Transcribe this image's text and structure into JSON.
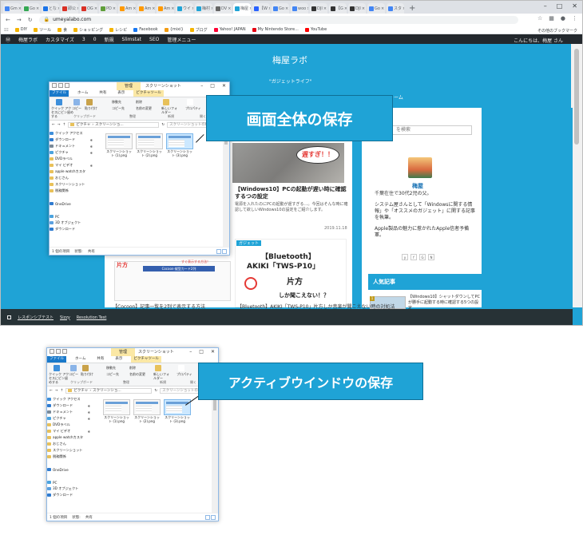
{
  "browser": {
    "tabs": [
      {
        "label": "Gm",
        "color": "#4285f4"
      },
      {
        "label": "Go",
        "color": "#34a853"
      },
      {
        "label": "とな",
        "color": "#1a73e8"
      },
      {
        "label": "即公",
        "color": "#d93025"
      },
      {
        "label": "OG",
        "color": "#d93025"
      },
      {
        "label": "PD",
        "color": "#5f9e3a"
      },
      {
        "label": "Am",
        "color": "#ff9900"
      },
      {
        "label": "Am",
        "color": "#ff9900"
      },
      {
        "label": "Am",
        "color": "#ff9900"
      },
      {
        "label": "ウイ",
        "color": "#1fa3d6"
      },
      {
        "label": "梅村",
        "color": "#1fa3d6"
      },
      {
        "label": "DV",
        "color": "#666666"
      },
      {
        "label": "梅屋",
        "color": "#1fa3d6",
        "active": true
      },
      {
        "label": "【W",
        "color": "#2962ff"
      },
      {
        "label": "Go",
        "color": "#4285f4"
      },
      {
        "label": "woo",
        "color": "#4285f4"
      },
      {
        "label": "DJI",
        "color": "#333333"
      },
      {
        "label": "【G",
        "color": "#333333"
      },
      {
        "label": "DJI",
        "color": "#333333"
      },
      {
        "label": "Go",
        "color": "#4285f4"
      },
      {
        "label": "スタ",
        "color": "#4285f4"
      }
    ],
    "url": "umeyalabo.com",
    "bookmarks": [
      {
        "label": "DIY",
        "color": "#f4b400"
      },
      {
        "label": "ツール",
        "color": "#f4b400"
      },
      {
        "label": "食",
        "color": "#f4b400"
      },
      {
        "label": "ショッピング",
        "color": "#f4b400"
      },
      {
        "label": "レシピ",
        "color": "#f4b400"
      },
      {
        "label": "Facebook",
        "color": "#1877f2"
      },
      {
        "label": "{mixi}",
        "color": "#f39c12"
      },
      {
        "label": "ブログ",
        "color": "#f4b400"
      },
      {
        "label": "Yahoo! JAPAN",
        "color": "#ff0033"
      },
      {
        "label": "My Nintendo Store...",
        "color": "#e60012"
      },
      {
        "label": "YouTube",
        "color": "#ff0000"
      }
    ],
    "bookmarks_right": "その他のブックマーク",
    "wp_admin": [
      "梅屋ラボ",
      "カスタマイズ",
      "3",
      "0",
      "新規",
      "Slimstat",
      "SEO",
      "管理メニュー"
    ],
    "wp_greeting": "こんにちは、梅屋 さん"
  },
  "site": {
    "title": "梅屋ラボ",
    "tagline": "\"ガジェットライフ\"",
    "nav": "フォーム",
    "search_placeholder": "を検索",
    "post1": {
      "bubble": "遅すぎ！！",
      "title": "【Windows10】PCの起動が遅い時に確認するつの設定",
      "excerpt": "電源を入れたのにPCの起動が遅すぎる…。今回はそんな時に確認して欲しいWindows10の設定をご紹介します。",
      "date": "2019.11.18"
    },
    "post2": {
      "badge": "ガジェット",
      "line1": "【Bluetooth】",
      "line2": "AKIKI「TWS-P10」",
      "line3": "片方",
      "line4": "しか聞こえない！？"
    },
    "author": {
      "name": "梅屋",
      "bio": [
        "千葉在住で30代2児の父。",
        "システム屋さんとして「Windowsに関する情報」や「オススメのガジェット」に関する記事を執筆。",
        "Apple製品の魅力に惹かれたApple信者予備軍。"
      ]
    },
    "social": [
      "y",
      "f",
      "G",
      "N"
    ],
    "popular_heading": "人気記事",
    "popular_item": "【Windows10】シャットダウンしてPCが勝手に起動する時に確認する5つの設定",
    "peek_red": "片方",
    "peek_bar": "Cocoon-縦型カード2列",
    "peek_bar2": "すぐ表示する方法！",
    "footer_left": "【Cocoon】記事一覧を2列で表示する方法",
    "footer_right": "【Bluetooth】AKIKI「TWS-P10」片方しか音楽が聞こえない時の対処法"
  },
  "recbar": [
    "レスポンシブテスト",
    "Sizzy",
    "Resolution Test"
  ],
  "explorer": {
    "manage_tab": "管理",
    "title": "スクリーンショット",
    "ribbon_tabs": [
      "ファイル",
      "ホーム",
      "共有",
      "表示",
      "ピクチャツール"
    ],
    "ribbon": {
      "quick_access": "クイック アクセスにピン留めする",
      "copy": "コピー",
      "paste": "貼り付け",
      "move_to": "移動先",
      "copy_to": "コピー先",
      "delete": "削除",
      "rename": "名前の変更",
      "new_folder": "新しいフォルダー",
      "properties": "プロパティ",
      "group_clipboard": "クリップボード",
      "group_organize": "整理",
      "group_new": "新規",
      "group_open": "開く"
    },
    "breadcrumb": [
      "ピクチャ",
      "スクリーンショ..."
    ],
    "search_placeholder": "スクリーンショットの検索",
    "nav": [
      {
        "label": "クイック アクセス",
        "color": "#3d8fdb",
        "pin": ""
      },
      {
        "label": "ダウンロード",
        "color": "#2f7bd0",
        "pin": "✱"
      },
      {
        "label": "ドキュメント",
        "color": "#7a8a99",
        "pin": "✱"
      },
      {
        "label": "ピクチャ",
        "color": "#4aa3df",
        "pin": "✱"
      },
      {
        "label": "DVDラベル",
        "color": "#e8c15a",
        "pin": ""
      },
      {
        "label": "マイ ビデオ",
        "color": "#e8c15a",
        "pin": "✱"
      },
      {
        "label": "apple watchカスタ",
        "color": "#e8c15a",
        "pin": ""
      },
      {
        "label": "おじさん",
        "color": "#e8c15a",
        "pin": ""
      },
      {
        "label": "スクリーンショット",
        "color": "#e8c15a",
        "pin": ""
      },
      {
        "label": "税務関係",
        "color": "#e8c15a",
        "pin": ""
      },
      {
        "label": "",
        "color": "transparent",
        "pin": ""
      },
      {
        "label": "OneDrive",
        "color": "#2f7bd0",
        "pin": ""
      },
      {
        "label": "",
        "color": "transparent",
        "pin": ""
      },
      {
        "label": "PC",
        "color": "#4aa3df",
        "pin": ""
      },
      {
        "label": "3D オブジェクト",
        "color": "#5aa0e0",
        "pin": ""
      },
      {
        "label": "ダウンロード",
        "color": "#2f7bd0",
        "pin": ""
      }
    ],
    "files": [
      "スクリーンショット (1).png",
      "スクリーンショット (2).png",
      "スクリーンショット (3).png"
    ],
    "status_count": "1 個の項目",
    "status_state": "状態: ",
    "status_shared": "共有"
  },
  "callouts": {
    "top": "画面全体の保存",
    "bottom": "アクティブウインドウの保存",
    "color": "#1fa3d6"
  }
}
